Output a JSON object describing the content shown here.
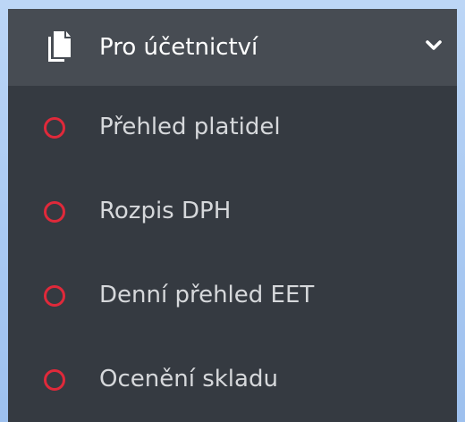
{
  "menu": {
    "header": {
      "label": "Pro účetnictví",
      "icon": "documents-icon",
      "chevron": "chevron-down-icon",
      "expanded": true
    },
    "items": [
      {
        "label": "Přehled platidel",
        "icon": "circle-outline-icon"
      },
      {
        "label": "Rozpis DPH",
        "icon": "circle-outline-icon"
      },
      {
        "label": "Denní přehled EET",
        "icon": "circle-outline-icon"
      },
      {
        "label": "Ocenění skladu",
        "icon": "circle-outline-icon"
      }
    ],
    "colors": {
      "panel_background": "#353a41",
      "header_background": "#474c53",
      "header_text": "#ffffff",
      "item_text": "#d6d8db",
      "circle_accent": "#e0293a"
    }
  }
}
